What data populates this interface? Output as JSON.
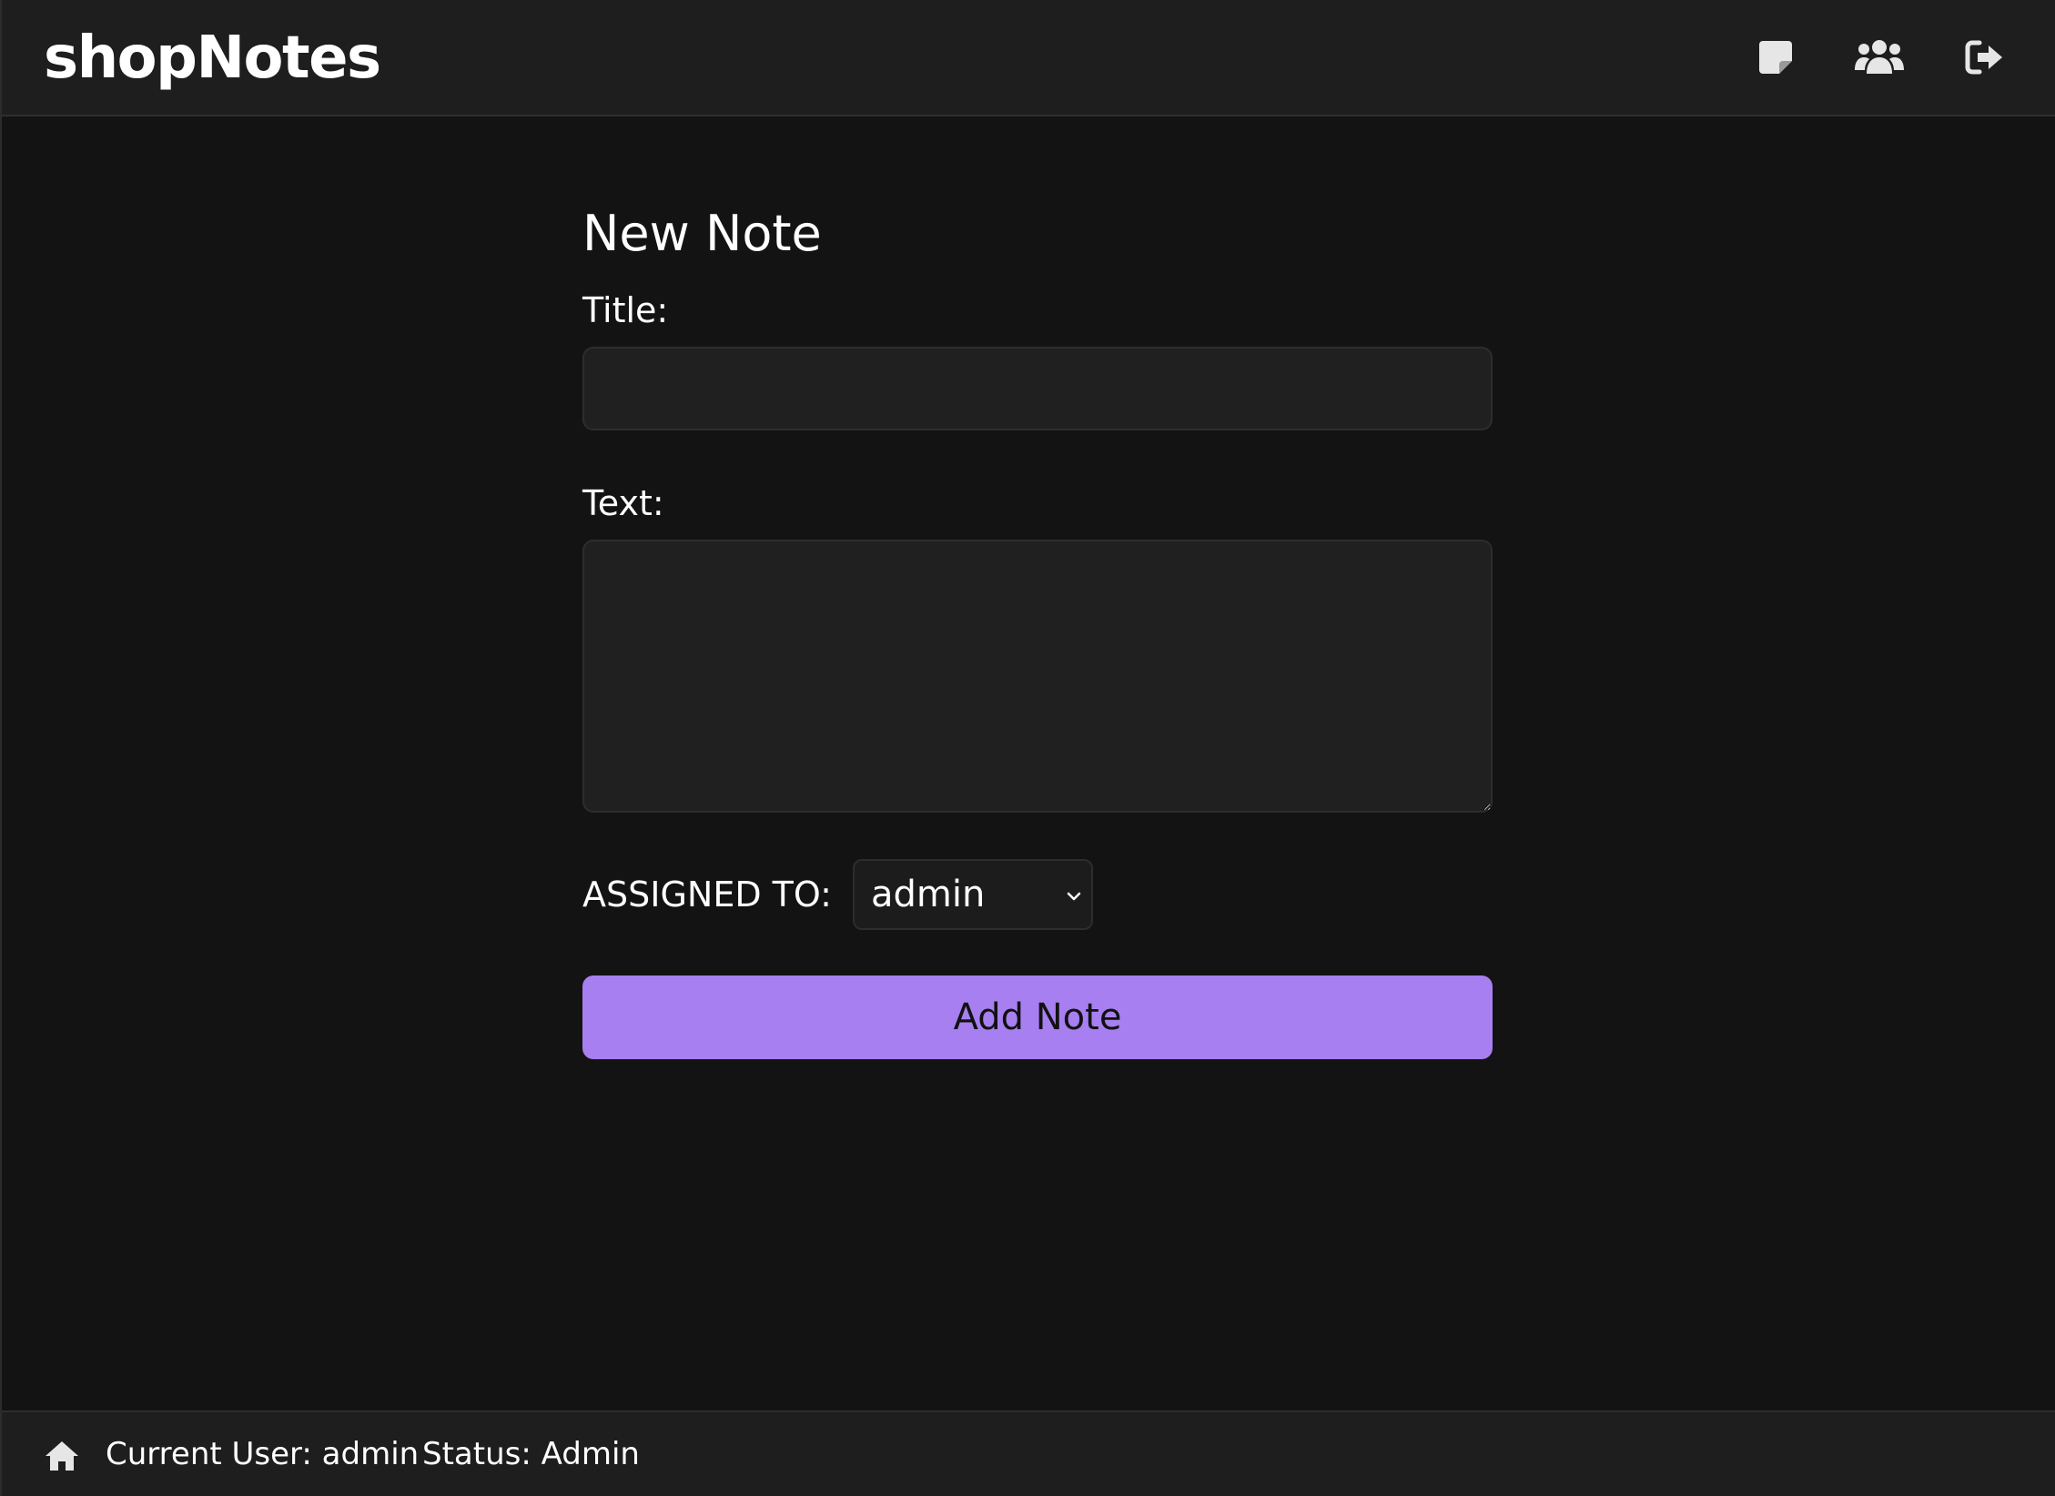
{
  "header": {
    "brand": "shopNotes",
    "nav_icons": [
      "note-add-icon",
      "users-icon",
      "logout-icon"
    ]
  },
  "form": {
    "heading": "New Note",
    "title_label": "Title:",
    "title_value": "",
    "text_label": "Text:",
    "text_value": "",
    "assigned_label": "ASSIGNED TO:",
    "assigned_value": "admin",
    "submit_label": "Add Note"
  },
  "footer": {
    "current_user": "Current User: admin",
    "status": "Status: Admin"
  },
  "colors": {
    "background": "#131313",
    "surface": "#1e1e1e",
    "input": "#202020",
    "accent": "#a77ff0"
  }
}
